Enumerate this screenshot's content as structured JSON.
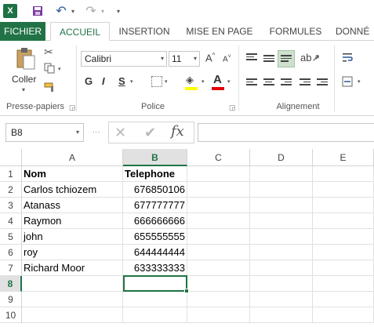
{
  "qat": {
    "app_icon": "X",
    "icons": [
      "excel-logo-icon",
      "save-icon",
      "undo-icon",
      "redo-icon",
      "customize-icon"
    ]
  },
  "tabs": [
    "FICHIER",
    "ACCUEIL",
    "INSERTION",
    "MISE EN PAGE",
    "FORMULES",
    "DONNÉ"
  ],
  "active_tab": "ACCUEIL",
  "ribbon": {
    "clipboard": {
      "paste_label": "Coller",
      "group_label": "Presse-papiers"
    },
    "font": {
      "name": "Calibri",
      "size": "11",
      "grow": "A",
      "shrink": "A",
      "bold": "G",
      "italic": "I",
      "underline": "S",
      "font_color_letter": "A",
      "group_label": "Police",
      "fill_color": "#ffff00",
      "font_color": "#e00000"
    },
    "alignment": {
      "group_label": "Alignement"
    }
  },
  "formula_bar": {
    "name_box": "B8",
    "cancel": "✕",
    "enter": "✔",
    "fx": "fx",
    "value": ""
  },
  "grid": {
    "columns": [
      "A",
      "B",
      "C",
      "D",
      "E"
    ],
    "rows": [
      "1",
      "2",
      "3",
      "4",
      "5",
      "6",
      "7",
      "8",
      "9",
      "10"
    ],
    "active_cell": "B8",
    "cells": {
      "a1": "Nom",
      "b1": "Telephone",
      "a2": "Carlos tchiozem",
      "b2": "676850106",
      "a3": "Atanass",
      "b3": "677777777",
      "a4": "Raymon",
      "b4": "666666666",
      "a5": "john",
      "b5": "655555555",
      "a6": "roy",
      "b6": "644444444",
      "a7": "Richard Moor",
      "b7": "633333333"
    }
  },
  "colors": {
    "accent": "#217346",
    "file_tab": "#217346"
  }
}
